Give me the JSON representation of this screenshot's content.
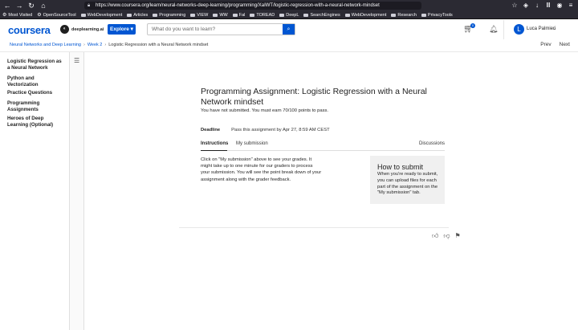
{
  "browser": {
    "url": "https://www.coursera.org/learn/neural-networks-deep-learning/programming/XaIWT/logistic-regression-with-a-neural-network-mindset",
    "bookmarks": [
      "Most Visited",
      "OpenSourceTool",
      "WebDevelopment",
      "Articles",
      "Programming",
      "VIEW",
      "WW",
      "Fal",
      "TOREAD",
      "DeepL",
      "SearchEngines",
      "WebDevelopment",
      "Research",
      "PrivacyTools"
    ]
  },
  "header": {
    "logo": "coursera",
    "partner": "deeplearning.ai",
    "explore_label": "Explore",
    "search_placeholder": "What do you want to learn?",
    "cart_count": "0",
    "username": "Luca Palmieri",
    "avatar_initial": "L"
  },
  "breadcrumb": {
    "course": "Neural Networks and Deep Learning",
    "week": "Week 2",
    "current": "Logistic Regression with a Neural Network mindset",
    "prev": "Prev",
    "next": "Next"
  },
  "sidebar": {
    "items": [
      {
        "label": "Logistic Regression as a Neural Network"
      },
      {
        "label": "Python and Vectorization"
      },
      {
        "label": "Practice Questions"
      },
      {
        "label": "Programming Assignments"
      },
      {
        "label": "Heroes of Deep Learning (Optional)"
      }
    ]
  },
  "main": {
    "title": "Programming Assignment: Logistic Regression with a Neural Network mindset",
    "status": "You have not submitted. You must earn 70/100 points to pass.",
    "deadline_label": "Deadline",
    "deadline_text": "Pass this assignment by Apr 27, 8:59 AM CEST",
    "tabs": {
      "instructions": "Instructions",
      "my_submission": "My submission",
      "discussions": "Discussions"
    },
    "instructions_text": "Click on \"My submission\" above to see your grades. It might take up to one minute for our graders to process your submission. You will see the point break down of your assignment along with the grader feedback.",
    "how_to_submit": {
      "title": "How to submit",
      "text": "When you're ready to submit, you can upload files for each part of the assignment on the \"My submission\" tab."
    }
  },
  "colors": {
    "brand_blue": "#0056d2",
    "browser_dark": "#2b2a33"
  }
}
